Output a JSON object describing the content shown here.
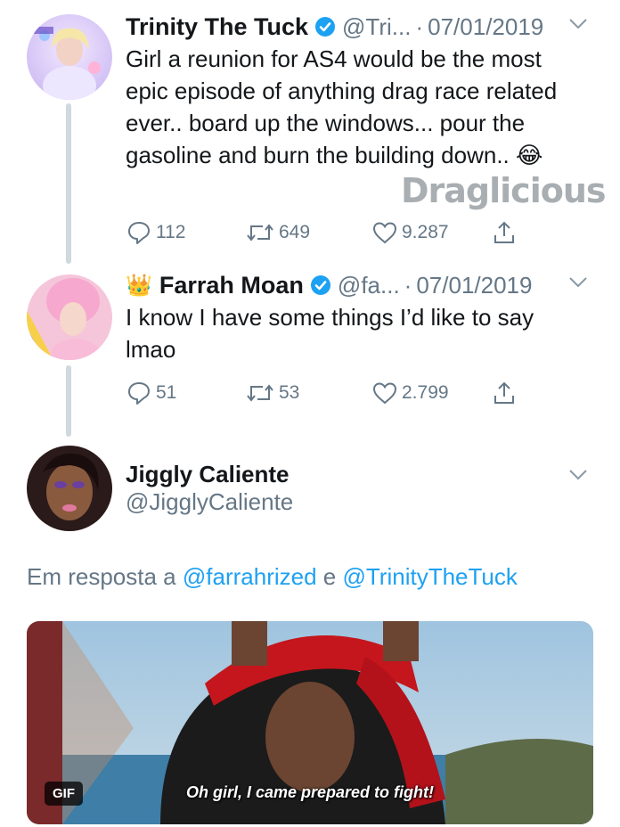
{
  "tweets": [
    {
      "name": "Trinity The Tuck",
      "handle": "@Tri...",
      "separator": "·",
      "date": "07/01/2019",
      "text": "Girl a reunion for AS4 would be the most epic episode of anything drag race related ever.. board up the windows... pour the gasoline and burn the building down.. 😂",
      "replies": "112",
      "retweets": "649",
      "likes": "9.287"
    },
    {
      "name_prefix_emoji": "👑",
      "name": "Farrah Moan",
      "handle": "@fa...",
      "separator": "·",
      "date": "07/01/2019",
      "text": "I know I have some things I’d like to say lmao",
      "replies": "51",
      "retweets": "53",
      "likes": "2.799"
    },
    {
      "name": "Jiggly Caliente",
      "handle": "@JigglyCaliente"
    }
  ],
  "reply_to": {
    "prefix": "Em resposta a",
    "mention1": "@farrahrized",
    "connector": "e",
    "mention2": "@TrinityTheTuck"
  },
  "media": {
    "badge": "GIF",
    "caption": "Oh girl, I came prepared to fight!"
  },
  "watermark": "Draglicious",
  "colors": {
    "accent": "#1da1f2",
    "muted": "#657786",
    "thread_line": "#cfd9de",
    "text": "#14171a"
  },
  "icons": [
    "verified-badge-icon",
    "chevron-down-icon",
    "reply-icon",
    "retweet-icon",
    "like-icon",
    "share-icon"
  ]
}
